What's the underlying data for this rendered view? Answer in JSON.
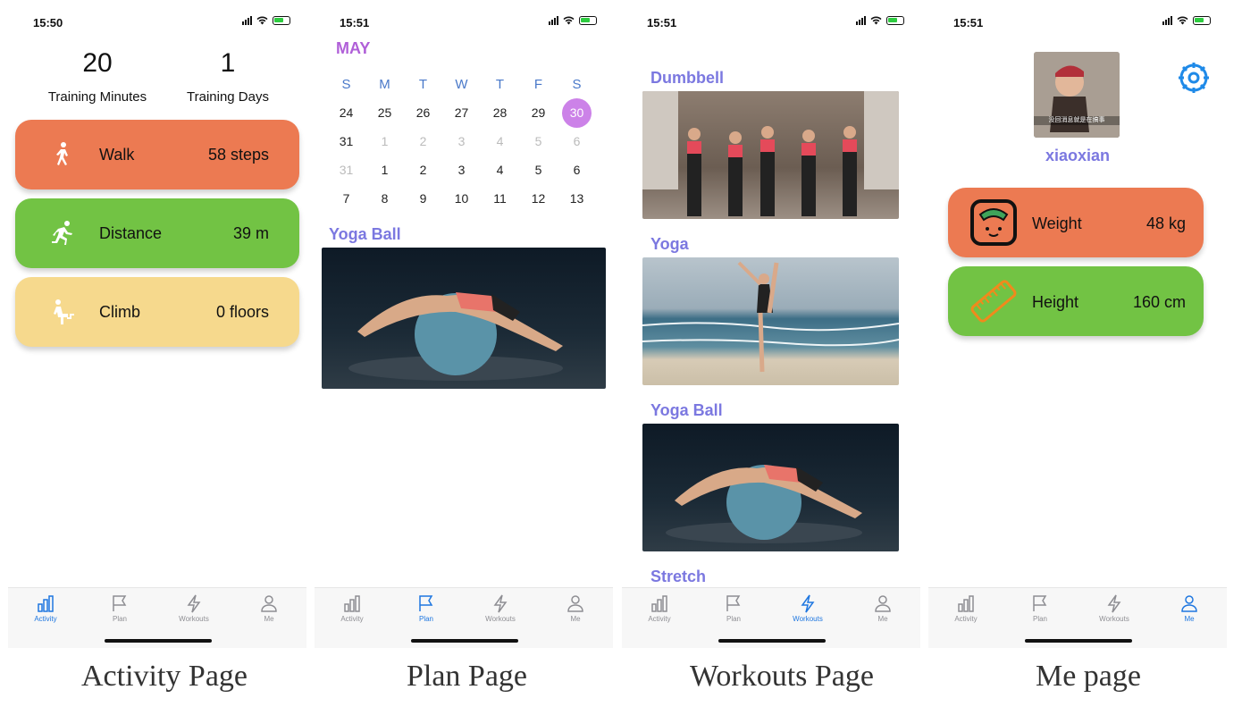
{
  "colors": {
    "walk": "#ec7a52",
    "distance": "#72c344",
    "climb": "#f6d98d",
    "accent": "#7b78e0",
    "tab_active": "#1f77e0",
    "selected_day": "#cc82e8"
  },
  "tabs": [
    "Activity",
    "Plan",
    "Workouts",
    "Me"
  ],
  "panels": {
    "activity": {
      "time": "15:50",
      "training_minutes_value": "20",
      "training_minutes_label": "Training Minutes",
      "training_days_value": "1",
      "training_days_label": "Training Days",
      "cards": [
        {
          "label": "Walk",
          "value": "58 steps",
          "icon": "walk-icon"
        },
        {
          "label": "Distance",
          "value": "39 m",
          "icon": "run-icon"
        },
        {
          "label": "Climb",
          "value": "0 floors",
          "icon": "climb-icon"
        }
      ],
      "caption": "Activity Page"
    },
    "plan": {
      "time": "15:51",
      "month": "MAY",
      "weekdays": [
        "S",
        "M",
        "T",
        "W",
        "T",
        "F",
        "S"
      ],
      "weeks": [
        [
          "24",
          "25",
          "26",
          "27",
          "28",
          "29",
          "30"
        ],
        [
          "31",
          "1",
          "2",
          "3",
          "4",
          "5",
          "6"
        ],
        [
          "31",
          "1",
          "2",
          "3",
          "4",
          "5",
          "6"
        ],
        [
          "7",
          "8",
          "9",
          "10",
          "11",
          "12",
          "13"
        ]
      ],
      "selected": "30",
      "section": "Yoga Ball",
      "caption": "Plan Page"
    },
    "workouts": {
      "time": "15:51",
      "sections": [
        "Dumbbell",
        "Yoga",
        "Yoga Ball",
        "Stretch"
      ],
      "caption": "Workouts Page"
    },
    "me": {
      "time": "15:51",
      "username": "xiaoxian",
      "avatar_text": "没回消息就是在搞事",
      "cards": [
        {
          "label": "Weight",
          "value": "48 kg",
          "icon": "scale-icon"
        },
        {
          "label": "Height",
          "value": "160 cm",
          "icon": "ruler-icon"
        }
      ],
      "caption": "Me page"
    }
  }
}
